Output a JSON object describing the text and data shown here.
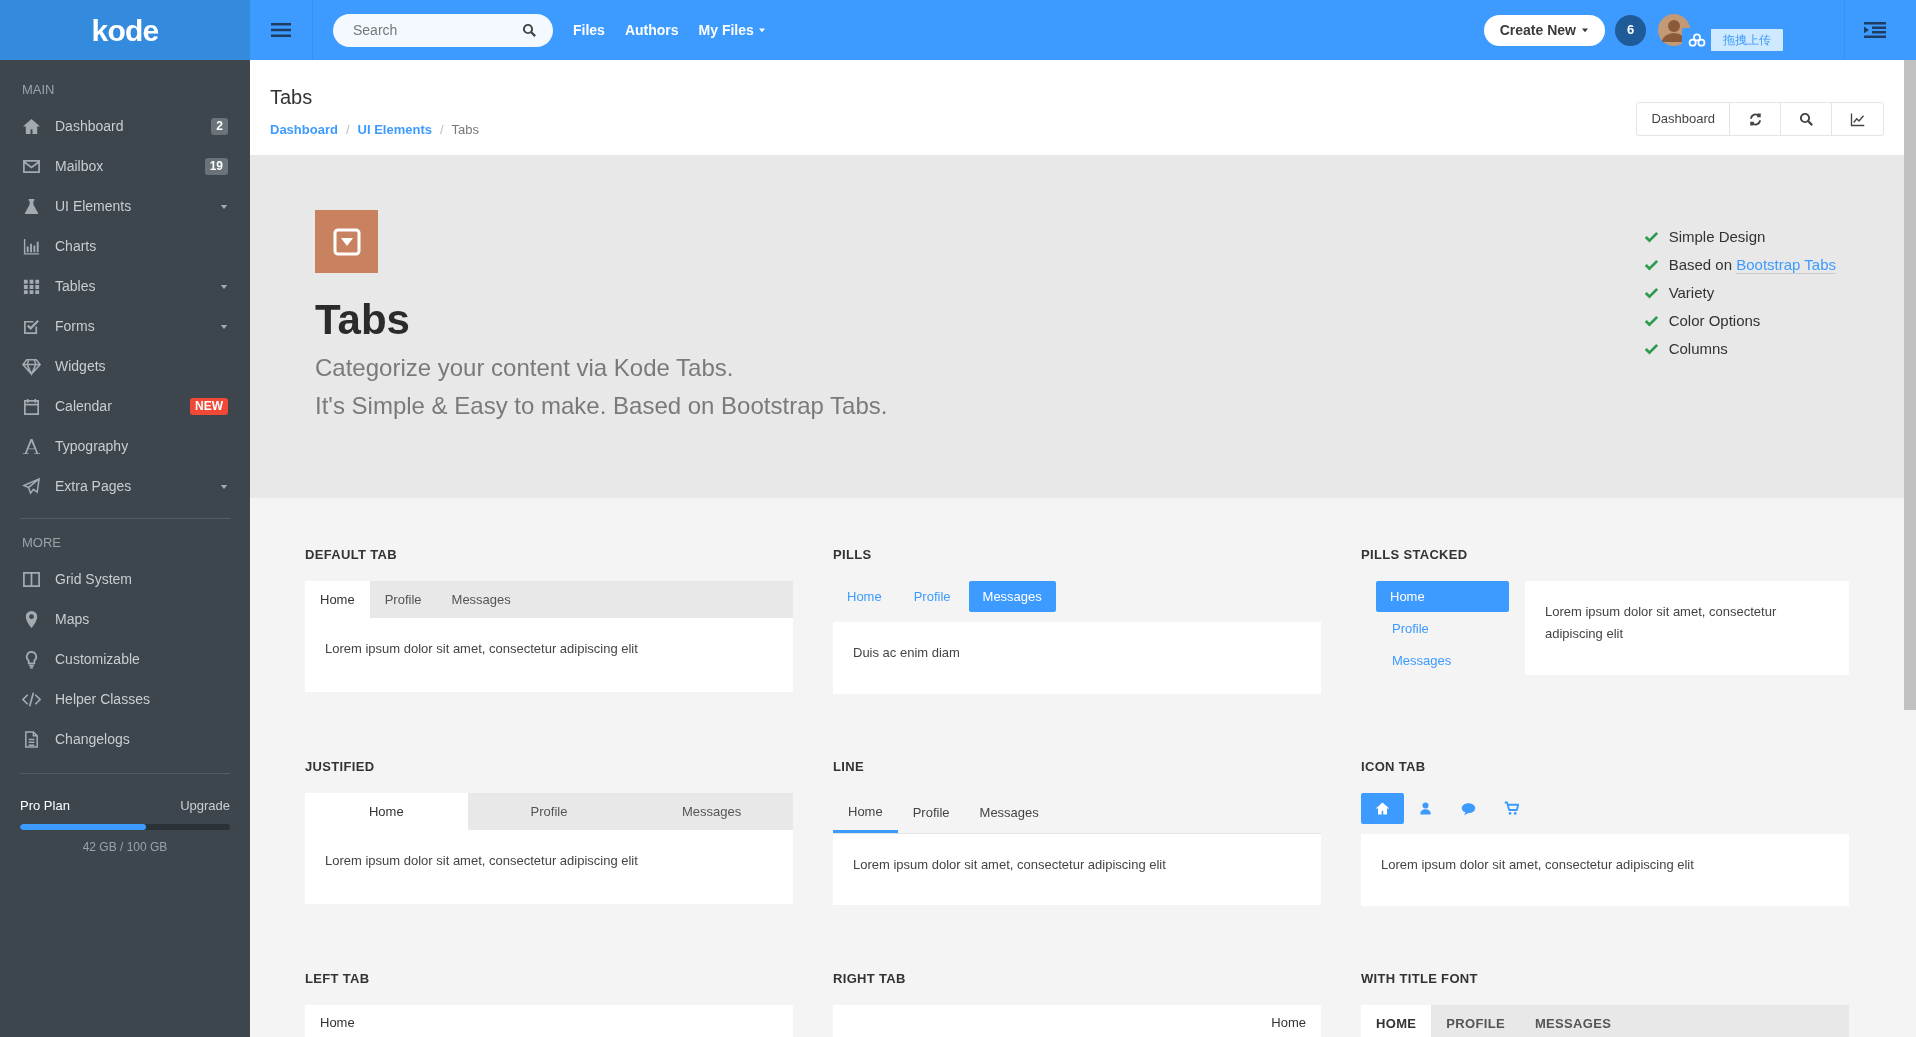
{
  "topbar": {
    "logo": "kode",
    "search": {
      "placeholder": "Search"
    },
    "links": [
      {
        "label": "Files",
        "dropdown": false
      },
      {
        "label": "Authors",
        "dropdown": false
      },
      {
        "label": "My Files",
        "dropdown": true
      }
    ],
    "create_button": "Create New",
    "notification_count": "6",
    "upload_widget": "拖拽上传"
  },
  "sidebar": {
    "sections": [
      {
        "heading": "MAIN",
        "items": [
          {
            "label": "Dashboard",
            "badge": {
              "text": "2",
              "color": "#6a7379"
            },
            "submenu": false
          },
          {
            "label": "Mailbox",
            "badge": {
              "text": "19",
              "color": "#6a7379"
            },
            "submenu": false
          },
          {
            "label": "UI Elements",
            "submenu": true
          },
          {
            "label": "Charts",
            "submenu": false
          },
          {
            "label": "Tables",
            "submenu": true
          },
          {
            "label": "Forms",
            "submenu": true
          },
          {
            "label": "Widgets",
            "submenu": false
          },
          {
            "label": "Calendar",
            "badge": {
              "text": "NEW",
              "color": "#f04a37"
            },
            "submenu": false
          },
          {
            "label": "Typography",
            "submenu": false
          },
          {
            "label": "Extra Pages",
            "submenu": true
          }
        ]
      },
      {
        "heading": "MORE",
        "items": [
          {
            "label": "Grid System",
            "submenu": false
          },
          {
            "label": "Maps",
            "submenu": false
          },
          {
            "label": "Customizable",
            "submenu": false
          },
          {
            "label": "Helper Classes",
            "submenu": false
          },
          {
            "label": "Changelogs",
            "submenu": false
          }
        ]
      }
    ],
    "plan": {
      "name": "Pro Plan",
      "action": "Upgrade",
      "level": 0.6,
      "usage": "42 GB / 100 GB"
    }
  },
  "page_header": {
    "title": "Tabs",
    "breadcrumbs": [
      {
        "label": "Dashboard",
        "link": true
      },
      {
        "label": "UI Elements",
        "link": true
      },
      {
        "label": "Tabs",
        "link": false
      }
    ],
    "separator": "/",
    "toolbar_label": "Dashboard"
  },
  "hero": {
    "title": "Tabs",
    "lines": [
      "Categorize your content via Kode Tabs.",
      "It's Simple & Easy to make. Based on Bootstrap Tabs."
    ],
    "features": [
      {
        "text": "Simple Design"
      },
      {
        "text": "Based on",
        "link": "Bootstrap Tabs"
      },
      {
        "text": "Variety"
      },
      {
        "text": "Color Options"
      },
      {
        "text": "Columns"
      }
    ]
  },
  "demos": [
    {
      "kind": "default",
      "title": "DEFAULT TAB",
      "tabs": [
        {
          "label": "Home",
          "selected": true
        },
        {
          "label": "Profile",
          "selected": false
        },
        {
          "label": "Messages",
          "selected": false
        }
      ],
      "content": "Lorem ipsum dolor sit amet, consectetur adipiscing elit"
    },
    {
      "kind": "pills",
      "title": "PILLS",
      "tabs": [
        {
          "label": "Home",
          "selected": false
        },
        {
          "label": "Profile",
          "selected": false
        },
        {
          "label": "Messages",
          "selected": true
        }
      ],
      "content": "Duis ac enim diam"
    },
    {
      "kind": "stacked",
      "title": "PILLS STACKED",
      "tabs": [
        {
          "label": "Home",
          "selected": true
        },
        {
          "label": "Profile",
          "selected": false
        },
        {
          "label": "Messages",
          "selected": false
        }
      ],
      "content": "Lorem ipsum dolor sit amet, consectetur adipiscing elit"
    },
    {
      "kind": "justified",
      "title": "JUSTIFIED",
      "tabs": [
        {
          "label": "Home",
          "selected": true
        },
        {
          "label": "Profile",
          "selected": false
        },
        {
          "label": "Messages",
          "selected": false
        }
      ],
      "content": "Lorem ipsum dolor sit amet, consectetur adipiscing elit"
    },
    {
      "kind": "line",
      "title": "LINE",
      "tabs": [
        {
          "label": "Home",
          "selected": true
        },
        {
          "label": "Profile",
          "selected": false
        },
        {
          "label": "Messages",
          "selected": false
        }
      ],
      "content": "Lorem ipsum dolor sit amet, consectetur adipiscing elit"
    },
    {
      "kind": "icon",
      "title": "ICON TAB",
      "tabs": [
        {
          "selected": true
        },
        {
          "selected": false
        },
        {
          "selected": false
        },
        {
          "selected": false
        }
      ],
      "content": "Lorem ipsum dolor sit amet, consectetur adipiscing elit"
    },
    {
      "kind": "left",
      "title": "LEFT TAB",
      "tabs": [
        {
          "label": "Home"
        }
      ]
    },
    {
      "kind": "right",
      "title": "RIGHT TAB",
      "tabs": [
        {
          "label": "Home"
        }
      ]
    },
    {
      "kind": "title_font",
      "title": "WITH TITLE FONT",
      "tabs": [
        {
          "label": "HOME",
          "selected": true
        },
        {
          "label": "PROFILE",
          "selected": false
        },
        {
          "label": "MESSAGES",
          "selected": false
        }
      ]
    }
  ]
}
